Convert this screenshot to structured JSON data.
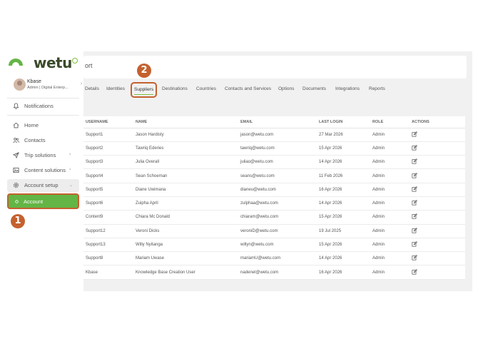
{
  "brand": {
    "logo_text": "wetu",
    "accent_green": "#63b545",
    "highlight_orange": "#c4612e"
  },
  "user": {
    "name": "Kbase",
    "subtitle": "Admin | Digital Enterp..."
  },
  "sidebar": {
    "notifications": "Notifications",
    "items": [
      {
        "label": "Home",
        "icon": "home-icon"
      },
      {
        "label": "Contacts",
        "icon": "users-icon"
      },
      {
        "label": "Trip solutions",
        "icon": "send-icon"
      },
      {
        "label": "Content solutions",
        "icon": "image-icon"
      },
      {
        "label": "Account setup",
        "icon": "gear-icon"
      },
      {
        "label": "Account",
        "icon": "dot-icon"
      }
    ]
  },
  "header": {
    "title_fragment": "ort"
  },
  "tabs": [
    "Details",
    "Identities",
    "Suppliers",
    "Destinations",
    "Countries",
    "Contacts and Services",
    "Options",
    "Documents",
    "Integrations",
    "Reports"
  ],
  "active_tab": "Suppliers",
  "badges": {
    "one": "1",
    "two": "2"
  },
  "table": {
    "columns": [
      "USERNAME",
      "NAME",
      "EMAIL",
      "LAST LOGIN",
      "ROLE",
      "ACTIONS"
    ],
    "rows": [
      [
        "Support1",
        "Jason Hardisty",
        "jason@wetu.com",
        "27 Mar 2026",
        "Admin"
      ],
      [
        "Support2",
        "Tawriq Ederies",
        "tawriq@wetu.com",
        "15 Apr 2026",
        "Admin"
      ],
      [
        "Support3",
        "Julia Overall",
        "juliao@wetu.com",
        "14 Apr 2026",
        "Admin"
      ],
      [
        "Support4",
        "Sean Schoeman",
        "seans@wetu.com",
        "11 Feb 2026",
        "Admin"
      ],
      [
        "Support5",
        "Diane Uwimana",
        "dianeu@wetu.com",
        "16 Apr 2026",
        "Admin"
      ],
      [
        "Support6",
        "Zuipha April",
        "zulphaa@wetu.com",
        "14 Apr 2026",
        "Admin"
      ],
      [
        "Content9",
        "Chiara Mc Donald",
        "chiaram@wetu.com",
        "15 Apr 2026",
        "Admin"
      ],
      [
        "Support12",
        "Veroni Dicks",
        "veroniD@wetu.com",
        "19 Jul 2025",
        "Admin"
      ],
      [
        "Support13",
        "Willy Nyitanga",
        "willyn@wetu.com",
        "15 Apr 2026",
        "Admin"
      ],
      [
        "Support8",
        "Mariam Uwase",
        "mariamU@wetu.com",
        "14 Apr 2026",
        "Admin"
      ],
      [
        "Kbase",
        "Knowledge Base Creation User",
        "nadenel@wetu.com",
        "16 Apr 2026",
        "Admin"
      ]
    ]
  }
}
